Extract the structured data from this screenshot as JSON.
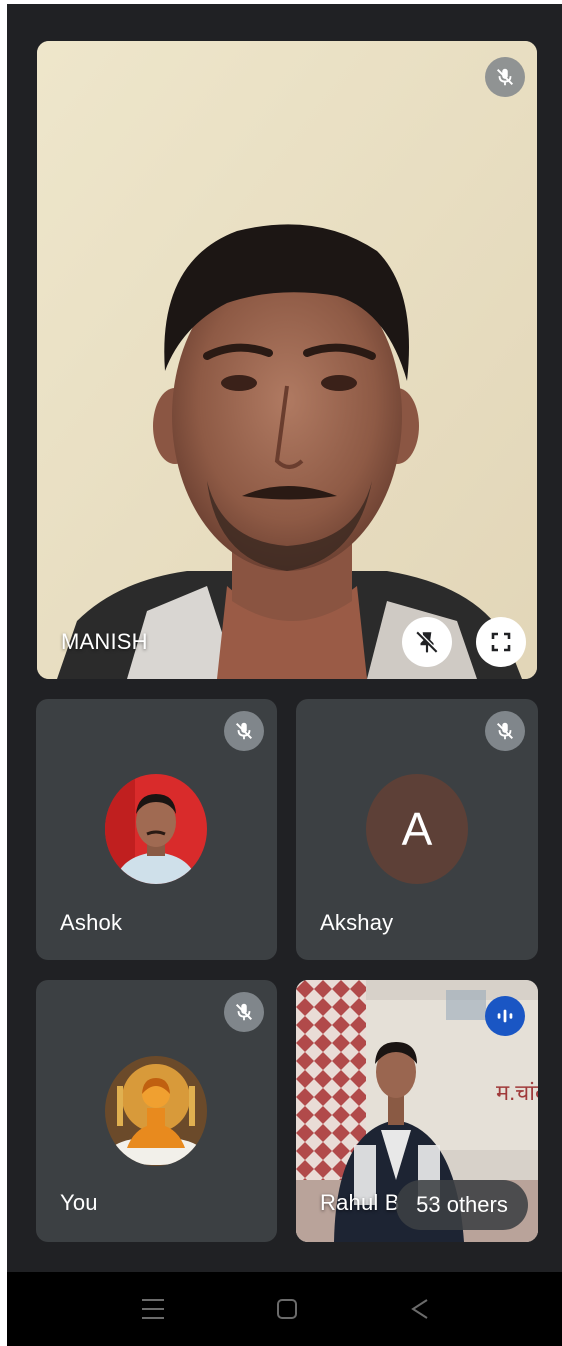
{
  "main_tile": {
    "name": "MANISH"
  },
  "tiles": [
    {
      "name": "Ashok",
      "avatar": "photo"
    },
    {
      "name": "Akshay",
      "avatar": "letter",
      "initial": "A",
      "color": "#5d4037"
    },
    {
      "name": "You",
      "avatar": "photo"
    },
    {
      "name": "Rahul B",
      "avatar": "video"
    }
  ],
  "others_chip": {
    "label": "53 others"
  },
  "icons": {
    "muted": "mic-off-icon",
    "unpin": "pin-off-icon",
    "fullscreen": "fullscreen-icon",
    "speaking": "audio-bars-icon",
    "nav": [
      "menu-icon",
      "home-icon",
      "back-icon"
    ]
  },
  "colors": {
    "tile": "#3c4043",
    "background": "#202124",
    "speaking": "#1a56c4"
  }
}
